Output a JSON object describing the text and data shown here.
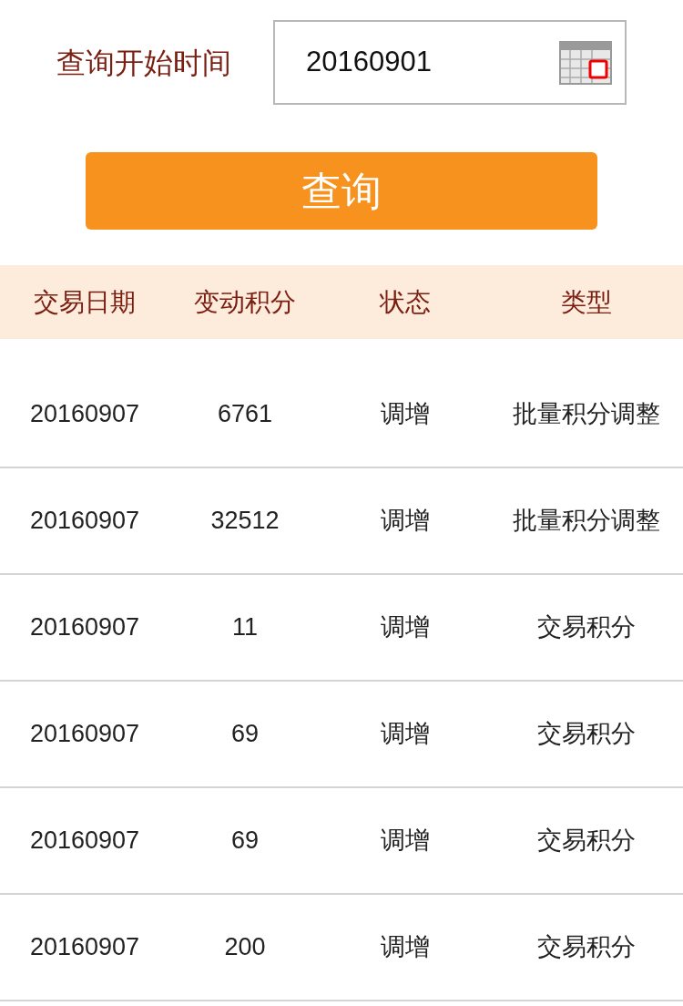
{
  "query": {
    "label": "查询开始时间",
    "date_value": "20160901",
    "button": "查询"
  },
  "table": {
    "columns": [
      "交易日期",
      "变动积分",
      "状态",
      "类型"
    ],
    "rows": [
      {
        "date": "20160907",
        "points": "6761",
        "status": "调增",
        "type": "批量积分调整"
      },
      {
        "date": "20160907",
        "points": "32512",
        "status": "调增",
        "type": "批量积分调整"
      },
      {
        "date": "20160907",
        "points": "11",
        "status": "调增",
        "type": "交易积分"
      },
      {
        "date": "20160907",
        "points": "69",
        "status": "调增",
        "type": "交易积分"
      },
      {
        "date": "20160907",
        "points": "69",
        "status": "调增",
        "type": "交易积分"
      },
      {
        "date": "20160907",
        "points": "200",
        "status": "调增",
        "type": "交易积分"
      }
    ]
  }
}
